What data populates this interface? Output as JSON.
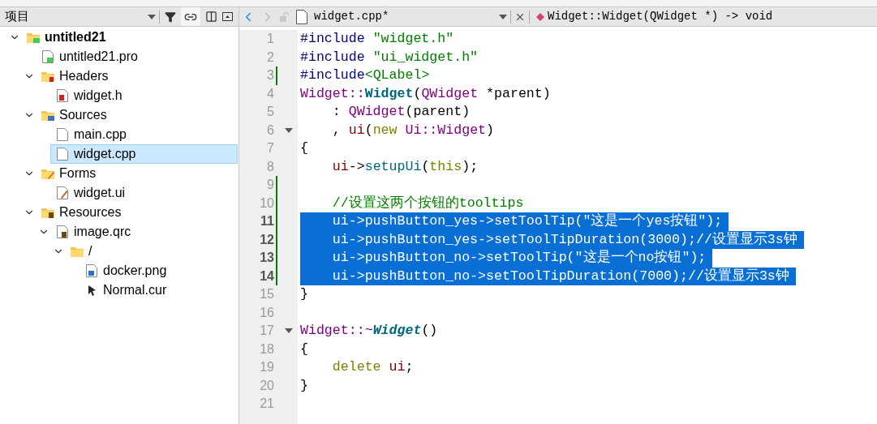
{
  "project_panel": {
    "title": "项目",
    "tree": [
      {
        "label": "untitled21",
        "kind": "project",
        "expanded": true,
        "selected": false,
        "children": [
          {
            "label": "untitled21.pro",
            "kind": "pro",
            "selected": false
          },
          {
            "label": "Headers",
            "kind": "folder-h",
            "expanded": true,
            "selected": false,
            "children": [
              {
                "label": "widget.h",
                "kind": "header",
                "selected": false
              }
            ]
          },
          {
            "label": "Sources",
            "kind": "folder-cpp",
            "expanded": true,
            "selected": false,
            "children": [
              {
                "label": "main.cpp",
                "kind": "file",
                "selected": false
              },
              {
                "label": "widget.cpp",
                "kind": "file",
                "selected": true
              }
            ]
          },
          {
            "label": "Forms",
            "kind": "folder-form",
            "expanded": true,
            "selected": false,
            "children": [
              {
                "label": "widget.ui",
                "kind": "form",
                "selected": false
              }
            ]
          },
          {
            "label": "Resources",
            "kind": "folder-res",
            "expanded": true,
            "selected": false,
            "children": [
              {
                "label": "image.qrc",
                "kind": "qrc",
                "expanded": true,
                "selected": false,
                "children": [
                  {
                    "label": "/",
                    "kind": "folder",
                    "expanded": true,
                    "selected": false,
                    "children": [
                      {
                        "label": "docker.png",
                        "kind": "image",
                        "selected": false
                      },
                      {
                        "label": "Normal.cur",
                        "kind": "cursor",
                        "selected": false
                      }
                    ]
                  }
                ]
              }
            ]
          }
        ]
      }
    ]
  },
  "editor_toolbar": {
    "file_name": "widget.cpp*",
    "symbol": "Widget::Widget(QWidget *) -> void",
    "back_enabled": true,
    "forward_enabled": false
  },
  "code": {
    "lines": [
      {
        "number": "1",
        "selected": false,
        "changed": false,
        "fold": false,
        "tokens": [
          {
            "text": "#include ",
            "kind": "pre"
          },
          {
            "text": "\"widget.h\"",
            "kind": "string"
          }
        ]
      },
      {
        "number": "2",
        "selected": false,
        "changed": false,
        "fold": false,
        "tokens": [
          {
            "text": "#include ",
            "kind": "pre"
          },
          {
            "text": "\"ui_widget.h\"",
            "kind": "string"
          }
        ]
      },
      {
        "number": "3",
        "selected": false,
        "changed": true,
        "fold": false,
        "tokens": [
          {
            "text": "#include",
            "kind": "pre"
          },
          {
            "text": "<QLabel>",
            "kind": "string"
          }
        ]
      },
      {
        "number": "4",
        "selected": false,
        "changed": false,
        "fold": false,
        "tokens": [
          {
            "text": "Widget::",
            "kind": "type"
          },
          {
            "text": "Widget",
            "kind": "decl"
          },
          {
            "text": "(",
            "kind": "plain"
          },
          {
            "text": "QWidget",
            "kind": "type"
          },
          {
            "text": " *parent)",
            "kind": "plain"
          }
        ]
      },
      {
        "number": "5",
        "selected": false,
        "changed": false,
        "fold": false,
        "tokens": [
          {
            "text": "    : ",
            "kind": "plain"
          },
          {
            "text": "QWidget",
            "kind": "type"
          },
          {
            "text": "(parent)",
            "kind": "plain"
          }
        ]
      },
      {
        "number": "6",
        "selected": false,
        "changed": false,
        "fold": true,
        "tokens": [
          {
            "text": "    , ",
            "kind": "plain"
          },
          {
            "text": "ui",
            "kind": "member"
          },
          {
            "text": "(",
            "kind": "plain"
          },
          {
            "text": "new ",
            "kind": "keyword"
          },
          {
            "text": "Ui::Widget",
            "kind": "type"
          },
          {
            "text": ")",
            "kind": "plain"
          }
        ]
      },
      {
        "number": "7",
        "selected": false,
        "changed": false,
        "fold": false,
        "tokens": [
          {
            "text": "{",
            "kind": "plain"
          }
        ]
      },
      {
        "number": "8",
        "selected": false,
        "changed": false,
        "fold": false,
        "tokens": [
          {
            "text": "    ui",
            "kind": "member"
          },
          {
            "text": "->",
            "kind": "plain"
          },
          {
            "text": "setupUi",
            "kind": "func"
          },
          {
            "text": "(",
            "kind": "plain"
          },
          {
            "text": "this",
            "kind": "keyword"
          },
          {
            "text": ");",
            "kind": "plain"
          }
        ]
      },
      {
        "number": "9",
        "selected": false,
        "changed": true,
        "fold": false
      },
      {
        "number": "10",
        "selected": false,
        "changed": true,
        "fold": false,
        "tokens": [
          {
            "text": "    //设置这两个按钮的tooltips",
            "kind": "comment"
          }
        ]
      },
      {
        "number": "11",
        "selected": true,
        "changed": true,
        "fold": false,
        "tokens": [
          {
            "text": "    ui->pushButton_yes->setToolTip(\"这是一个yes按钮\");"
          }
        ]
      },
      {
        "number": "12",
        "selected": true,
        "changed": true,
        "fold": false,
        "tokens": [
          {
            "text": "    ui->pushButton_yes->setToolTipDuration(3000);//设置显示3s钟"
          }
        ]
      },
      {
        "number": "13",
        "selected": true,
        "changed": true,
        "fold": false,
        "tokens": [
          {
            "text": "    ui->pushButton_no->setToolTip(\"这是一个no按钮\");"
          }
        ]
      },
      {
        "number": "14",
        "selected": true,
        "changed": true,
        "fold": false,
        "tokens": [
          {
            "text": "    ui->pushButton_no->setToolTipDuration(7000);//设置显示3s钟"
          }
        ]
      },
      {
        "number": "15",
        "selected": false,
        "changed": false,
        "fold": false,
        "tokens": [
          {
            "text": "}",
            "kind": "plain"
          }
        ]
      },
      {
        "number": "16",
        "selected": false,
        "changed": false,
        "fold": false
      },
      {
        "number": "17",
        "selected": false,
        "changed": false,
        "fold": true,
        "tokens": [
          {
            "text": "Widget::~",
            "kind": "type"
          },
          {
            "text": "Widget",
            "kind": "dtor"
          },
          {
            "text": "()",
            "kind": "plain"
          }
        ]
      },
      {
        "number": "18",
        "selected": false,
        "changed": false,
        "fold": false,
        "tokens": [
          {
            "text": "{",
            "kind": "plain"
          }
        ]
      },
      {
        "number": "19",
        "selected": false,
        "changed": false,
        "fold": false,
        "tokens": [
          {
            "text": "    delete ",
            "kind": "keyword"
          },
          {
            "text": "ui",
            "kind": "member"
          },
          {
            "text": ";",
            "kind": "plain"
          }
        ]
      },
      {
        "number": "20",
        "selected": false,
        "changed": false,
        "fold": false,
        "tokens": [
          {
            "text": "}",
            "kind": "plain"
          }
        ]
      },
      {
        "number": "21",
        "selected": false,
        "changed": false,
        "fold": false
      }
    ]
  }
}
